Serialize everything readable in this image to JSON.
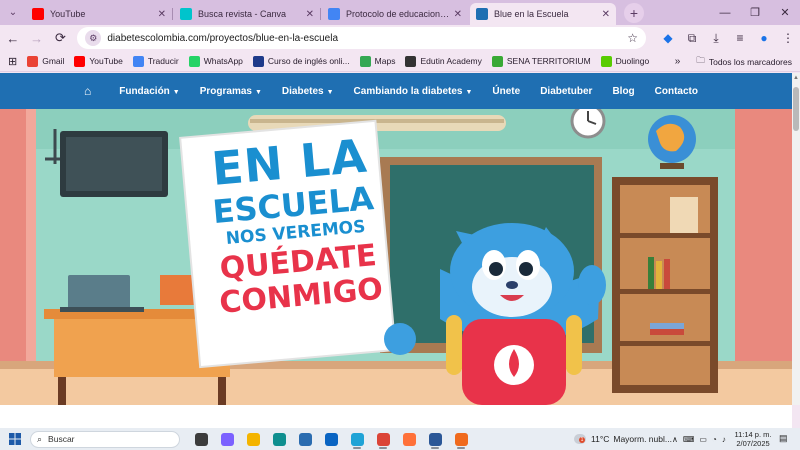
{
  "browser": {
    "tabs": [
      {
        "title": "YouTube",
        "icon": "youtube-icon",
        "color": "#ff0000",
        "active": false
      },
      {
        "title": "Busca revista - Canva",
        "icon": "canva-icon",
        "color": "#00c4cc",
        "active": false
      },
      {
        "title": "Protocolo de educacion en salu",
        "icon": "docs-icon",
        "color": "#4285f4",
        "active": false
      },
      {
        "title": "Blue en la Escuela",
        "icon": "site-icon",
        "color": "#1f6fb2",
        "active": true
      }
    ],
    "new_tab_label": "+",
    "address": {
      "url": "diabetescolombia.com/proyectos/blue-en-la-escuela"
    },
    "bookmarks": [
      {
        "label": "Gmail",
        "icon": "gmail-icon",
        "color": "#ea4335"
      },
      {
        "label": "YouTube",
        "icon": "youtube-icon",
        "color": "#ff0000"
      },
      {
        "label": "Traducir",
        "icon": "translate-icon",
        "color": "#4285f4"
      },
      {
        "label": "WhatsApp",
        "icon": "whatsapp-icon",
        "color": "#25d366"
      },
      {
        "label": "Curso de inglés onli...",
        "icon": "course-icon",
        "color": "#1e3a8a"
      },
      {
        "label": "Maps",
        "icon": "maps-icon",
        "color": "#34a853"
      },
      {
        "label": "Edutin Academy",
        "icon": "edutin-icon",
        "color": "#333333"
      },
      {
        "label": "SENA TERRITORIUM",
        "icon": "sena-icon",
        "color": "#39a935"
      },
      {
        "label": "Duolingo",
        "icon": "duolingo-icon",
        "color": "#58cc02"
      }
    ],
    "all_bookmarks_label": "Todos los marcadores"
  },
  "site": {
    "nav": [
      {
        "label": "Fundación",
        "dropdown": true
      },
      {
        "label": "Programas",
        "dropdown": true
      },
      {
        "label": "Diabetes",
        "dropdown": true
      },
      {
        "label": "Cambiando la diabetes",
        "dropdown": true
      },
      {
        "label": "Únete",
        "dropdown": false
      },
      {
        "label": "Diabetuber",
        "dropdown": false
      },
      {
        "label": "Blog",
        "dropdown": false
      },
      {
        "label": "Contacto",
        "dropdown": false
      }
    ],
    "nav_color": "#1f6fb2",
    "hero": {
      "line1": "EN LA",
      "line2": "ESCUELA",
      "line3": "NOS VEREMOS",
      "line4": "QUÉDATE",
      "line5": "CONMIGO",
      "blue_text_color": "#1a8fd0",
      "red_text_color": "#e8334a"
    }
  },
  "taskbar": {
    "search_placeholder": "Buscar",
    "apps": [
      {
        "name": "task-view-icon",
        "color": "#3c3c3c",
        "running": false
      },
      {
        "name": "copilot-icon",
        "color": "#7b61ff",
        "running": false
      },
      {
        "name": "file-explorer-icon",
        "color": "#f4b400",
        "running": false
      },
      {
        "name": "edge-icon",
        "color": "#0f8f8f",
        "running": false
      },
      {
        "name": "store-icon",
        "color": "#2b6cb0",
        "running": false
      },
      {
        "name": "outlook-icon",
        "color": "#0a64c2",
        "running": false
      },
      {
        "name": "app-icon",
        "color": "#1fa3d6",
        "running": true
      },
      {
        "name": "chrome-icon",
        "color": "#db4437",
        "running": true
      },
      {
        "name": "firefox-icon",
        "color": "#ff7139",
        "running": false
      },
      {
        "name": "word-icon",
        "color": "#2b5797",
        "running": true
      },
      {
        "name": "cutout-icon",
        "color": "#f06a1d",
        "running": true
      }
    ],
    "weather": {
      "temp": "11°C",
      "desc": "Mayorm. nubl...",
      "badge": "1"
    },
    "time": "11:14 p. m.",
    "date": "2/07/2025"
  }
}
